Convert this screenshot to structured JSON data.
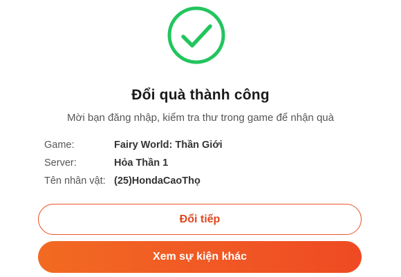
{
  "status": {
    "icon": "check-circle-icon",
    "color": "#22c55e"
  },
  "title": "Đổi quà thành công",
  "subtitle": "Mời bạn đăng nhập, kiểm tra thư trong game để nhận quà",
  "details": [
    {
      "label": "Game:",
      "value": "Fairy World: Thần Giới"
    },
    {
      "label": "Server:",
      "value": "Hỏa Thần 1"
    },
    {
      "label": "Tên nhân vật:",
      "value": "(25)HondaCaoThọ"
    }
  ],
  "buttons": {
    "continue_label": "Đổi tiếp",
    "other_events_label": "Xem sự kiện khác"
  },
  "colors": {
    "accent": "#ef4a23",
    "success": "#22c55e"
  }
}
